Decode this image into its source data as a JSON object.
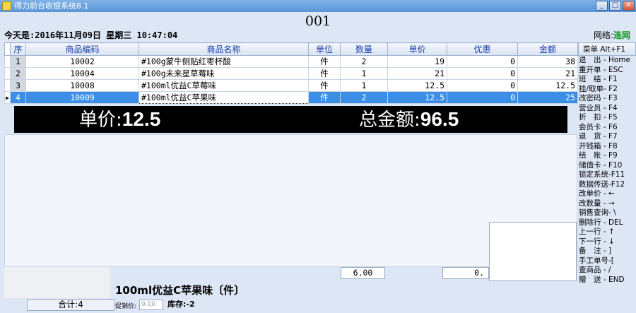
{
  "window": {
    "title": "得力前台收银系统8.1"
  },
  "header": {
    "order_no": "001",
    "date_label": "今天是:",
    "date_value": "2016年11月09日 星期三 10:47:04",
    "network_label": "网络:",
    "network_status": "连网"
  },
  "table": {
    "columns": [
      "序",
      "商品编码",
      "商品名称",
      "单位",
      "数量",
      "单价",
      "优惠",
      "金额"
    ],
    "rows": [
      {
        "seq": "1",
        "code": "10002",
        "name": "#100g蒙牛侧贴红枣杯酸",
        "unit": "件",
        "qty": "2",
        "price": "19",
        "discount": "0",
        "amount": "38"
      },
      {
        "seq": "2",
        "code": "10004",
        "name": "#100g未来星草莓味",
        "unit": "件",
        "qty": "1",
        "price": "21",
        "discount": "0",
        "amount": "21"
      },
      {
        "seq": "3",
        "code": "10008",
        "name": "#100ml优益C草莓味",
        "unit": "件",
        "qty": "1",
        "price": "12.5",
        "discount": "0",
        "amount": "12.5"
      },
      {
        "seq": "4",
        "code": "10009",
        "name": "#100ml优益C苹果味",
        "unit": "件",
        "qty": "2",
        "price": "12.5",
        "discount": "0",
        "amount": "25"
      }
    ],
    "selected_row": 4
  },
  "display": {
    "unit_price_label": "单价:",
    "unit_price_value": "12.5",
    "total_label": "总金额:",
    "total_value": "96.5"
  },
  "menu": {
    "header": "菜单 Alt+F1",
    "items": [
      "退　出 - Home",
      "重开单 - ESC",
      "班　结 - F1",
      "挂/取单- F2",
      "改密码 - F3",
      "营业员 - F4",
      "折　扣 - F5",
      "会员卡 - F6",
      "退　货 - F7",
      "开钱箱 - F8",
      "结　账 - F9",
      "储值卡 - F10",
      "锁定系统-F11",
      "数据传送-F12",
      "改单价 - ←",
      "改数量 - →",
      "销售查询- \\",
      "删除行 - DEL",
      "上一行 - ↑",
      "下一行 - ↓",
      "备　注 - ]",
      "手工单号-[",
      "查商品 - /",
      "赠　送 - END"
    ]
  },
  "summary": {
    "qty_total": "6.00",
    "discount_total": "0.",
    "count_label": "合计:4"
  },
  "product_info": {
    "title": "100ml优益C苹果味〔件〕",
    "promo_label": "促销价:",
    "promo_placeholder": "0.00",
    "stock_label": "库存:-2"
  },
  "colors": {
    "selection": "#3b8ee6",
    "header_text": "#1a3fa8",
    "network_ok": "#0a9a1a",
    "display_bg": "#000000"
  }
}
